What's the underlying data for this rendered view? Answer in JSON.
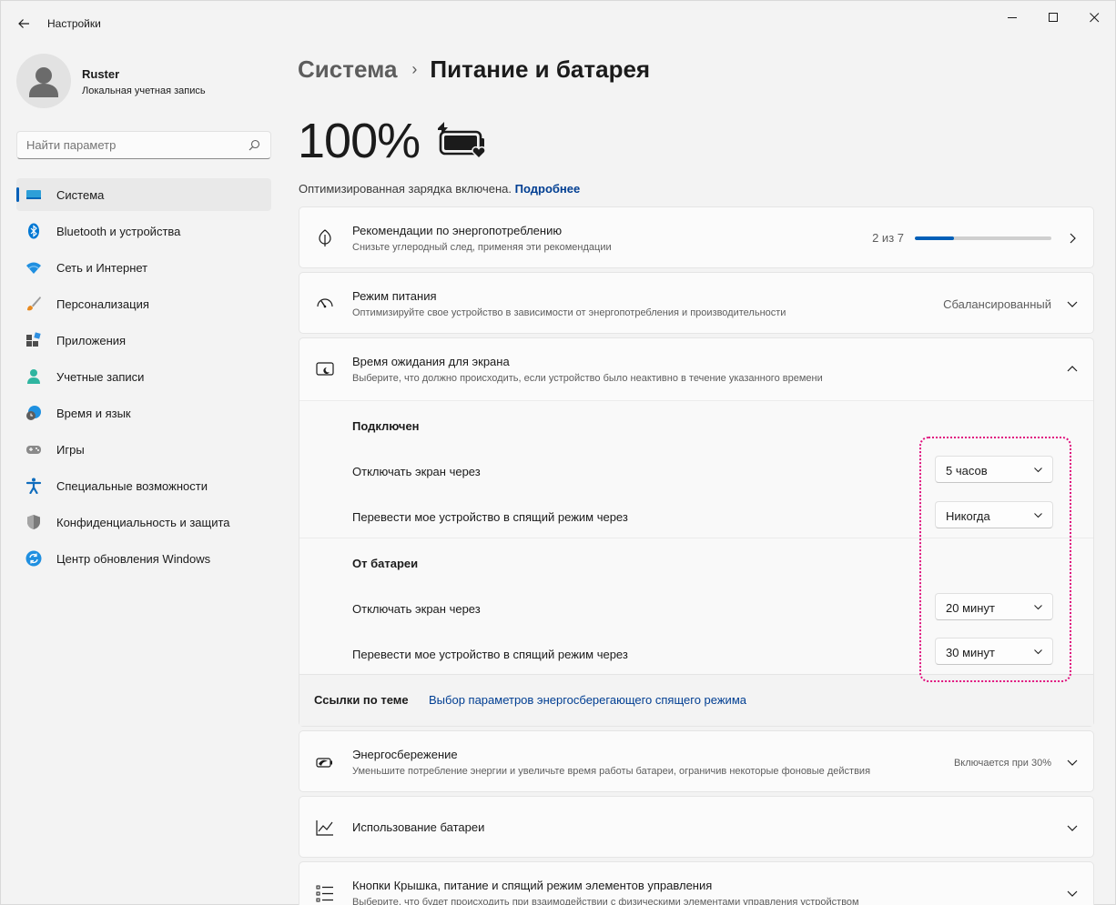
{
  "window": {
    "title": "Настройки"
  },
  "profile": {
    "name": "Ruster",
    "account_type": "Локальная учетная запись"
  },
  "search": {
    "placeholder": "Найти параметр"
  },
  "nav": {
    "items": [
      {
        "label": "Система",
        "icon": "system-icon",
        "active": true
      },
      {
        "label": "Bluetooth и устройства",
        "icon": "bluetooth-icon"
      },
      {
        "label": "Сеть и Интернет",
        "icon": "wifi-icon"
      },
      {
        "label": "Персонализация",
        "icon": "brush-icon"
      },
      {
        "label": "Приложения",
        "icon": "apps-icon"
      },
      {
        "label": "Учетные записи",
        "icon": "accounts-icon"
      },
      {
        "label": "Время и язык",
        "icon": "time-language-icon"
      },
      {
        "label": "Игры",
        "icon": "gamepad-icon"
      },
      {
        "label": "Специальные возможности",
        "icon": "accessibility-icon"
      },
      {
        "label": "Конфиденциальность и защита",
        "icon": "shield-icon"
      },
      {
        "label": "Центр обновления Windows",
        "icon": "update-icon"
      }
    ]
  },
  "breadcrumb": {
    "parent": "Система",
    "separator": "›",
    "current": "Питание и батарея"
  },
  "battery": {
    "percent": "100%",
    "optimized_text": "Оптимизированная зарядка включена.",
    "more_link": "Подробнее"
  },
  "cards": {
    "recommendations": {
      "title": "Рекомендации по энергопотреблению",
      "subtitle": "Снизьте углеродный след, применяя эти рекомендации",
      "progress_text": "2 из 7",
      "progress": 0.2857
    },
    "power_mode": {
      "title": "Режим питания",
      "subtitle": "Оптимизируйте свое устройство в зависимости от энергопотребления и производительности",
      "value": "Сбалансированный"
    },
    "screen_timeout": {
      "title": "Время ожидания для экрана",
      "subtitle": "Выберите, что должно происходить, если устройство было неактивно в течение указанного времени",
      "plugged": {
        "heading": "Подключен",
        "screen_off_label": "Отключать экран через",
        "screen_off_value": "5 часов",
        "sleep_label": "Перевести мое устройство в спящий режим через",
        "sleep_value": "Никогда"
      },
      "battery": {
        "heading": "От батареи",
        "screen_off_label": "Отключать экран через",
        "screen_off_value": "20 минут",
        "sleep_label": "Перевести мое устройство в спящий режим через",
        "sleep_value": "30 минут"
      },
      "related_label": "Ссылки по теме",
      "related_link": "Выбор параметров энергосберегающего спящего режима"
    },
    "energy_saver": {
      "title": "Энергосбережение",
      "subtitle": "Уменьшите потребление энергии и увеличьте время работы батареи, ограничив некоторые фоновые действия",
      "value": "Включается при 30%"
    },
    "battery_usage": {
      "title": "Использование батареи"
    },
    "lid_buttons": {
      "title": "Кнопки Крышка, питание и спящий режим элементов управления",
      "subtitle": "Выберите, что будет происходить при взаимодействии с физическими элементами управления устройством"
    }
  },
  "colors": {
    "accent": "#005fb8",
    "link": "#003e92",
    "highlight": "#e0107e"
  }
}
